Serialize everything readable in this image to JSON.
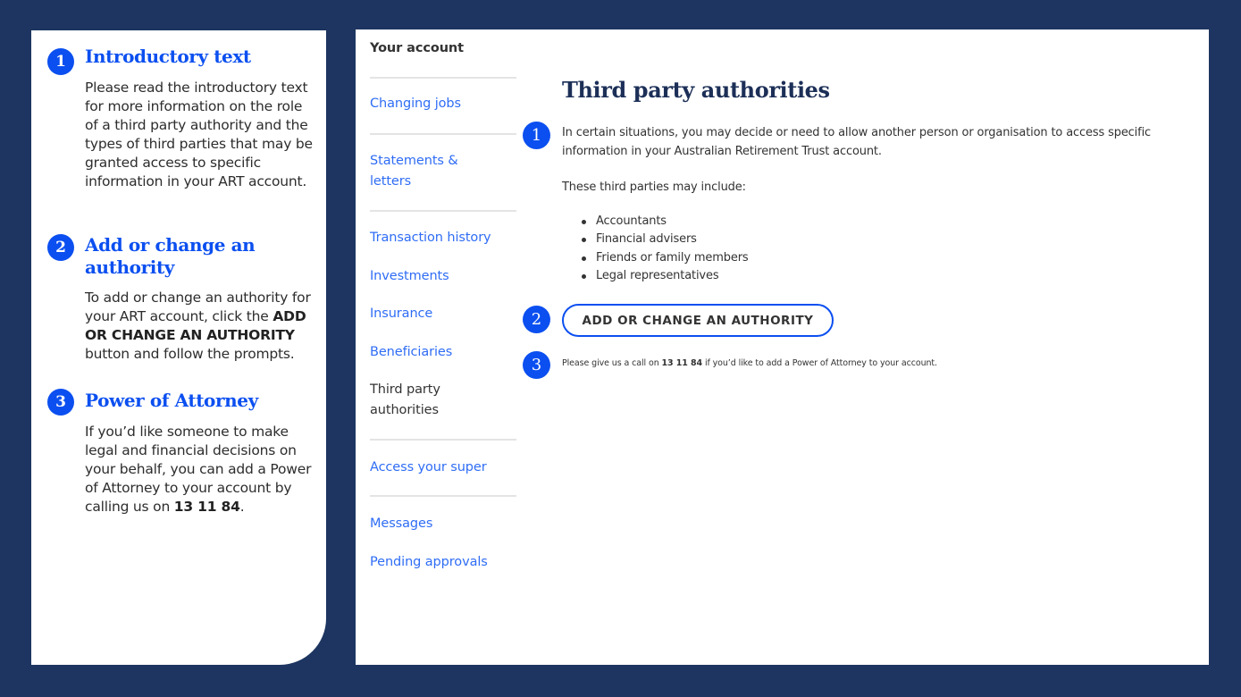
{
  "colors": {
    "frame_background": "#1d3560",
    "accent_blue": "#0b4ff0",
    "nav_link": "#2f6df5",
    "title_navy": "#1c2f57"
  },
  "explainer": {
    "sections": [
      {
        "number": "1",
        "title": "Introductory text",
        "body": "Please read the introductory text for more information on the role of a third party authority and the types of third parties that may be granted access to specific information in your ART account."
      },
      {
        "number": "2",
        "title": "Add or change an authority",
        "body_before": "To add or change an authority for your ART account, click the ",
        "body_bold": "ADD OR CHANGE AN AUTHORITY",
        "body_after": " button and follow the prompts."
      },
      {
        "number": "3",
        "title": "Power of Attorney",
        "body_before": "If you’d like someone to make legal and financial decisions on your behalf, you can add a Power of Attorney to your account by calling us on ",
        "body_bold": "13 11 84",
        "body_after": "."
      }
    ]
  },
  "screen": {
    "nav": {
      "heading": "Your account",
      "items": [
        {
          "label": "Changing jobs",
          "active": false
        },
        {
          "label": "Statements & letters",
          "active": false
        },
        {
          "label": "Transaction history",
          "active": false
        },
        {
          "label": "Investments",
          "active": false
        },
        {
          "label": "Insurance",
          "active": false
        },
        {
          "label": "Beneficiaries",
          "active": false
        },
        {
          "label": "Third party authorities",
          "active": true
        },
        {
          "label": "Access your super",
          "active": false
        },
        {
          "label": "Messages",
          "active": false
        },
        {
          "label": "Pending approvals",
          "active": false
        }
      ]
    },
    "content": {
      "title": "Third party authorities",
      "intro": "In certain situations, you may decide or need to allow another person or organisation to access specific information in your Australian Retirement Trust account.",
      "include_label": "These third parties may include:",
      "third_parties": [
        "Accountants",
        "Financial advisers",
        "Friends or family members",
        "Legal representatives"
      ],
      "cta_label": "ADD OR CHANGE AN AUTHORITY",
      "poa_note_before": "Please give us a call on ",
      "poa_note_phone": "13 11 84",
      "poa_note_after": " if you’d like to add a Power of Attorney to your account."
    },
    "markers": [
      "1",
      "2",
      "3"
    ]
  }
}
